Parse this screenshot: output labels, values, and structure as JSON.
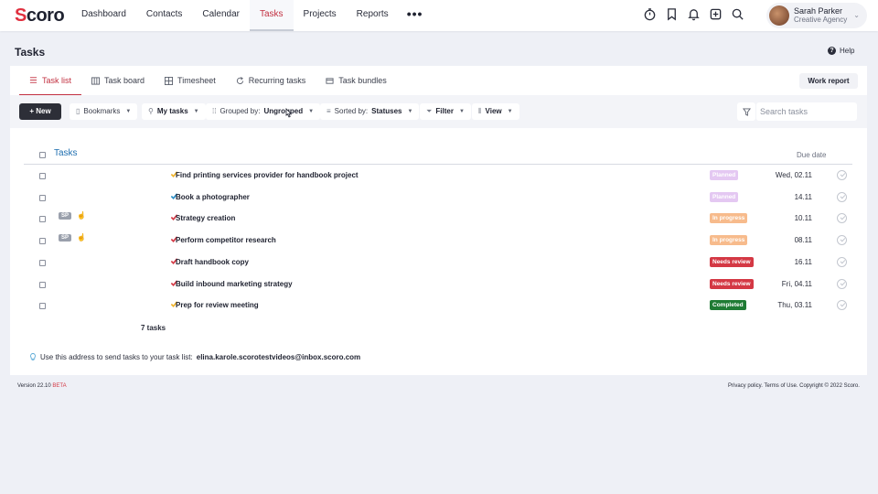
{
  "app": {
    "logo_text": "Scoro",
    "nav": [
      {
        "label": "Dashboard",
        "active": false
      },
      {
        "label": "Contacts",
        "active": false
      },
      {
        "label": "Calendar",
        "active": false
      },
      {
        "label": "Tasks",
        "active": true
      },
      {
        "label": "Projects",
        "active": false
      },
      {
        "label": "Reports",
        "active": false
      }
    ],
    "more_label": "•••",
    "icons": [
      "timer-icon",
      "bookmark-icon",
      "bell-icon",
      "add-icon",
      "search-icon"
    ],
    "user": {
      "name": "Sarah Parker",
      "org": "Creative Agency"
    }
  },
  "page": {
    "title": "Tasks",
    "help_label": "Help"
  },
  "tabs": [
    {
      "label": "Task list",
      "icon": "list-icon",
      "active": true
    },
    {
      "label": "Task board",
      "icon": "board-icon",
      "active": false
    },
    {
      "label": "Timesheet",
      "icon": "grid-icon",
      "active": false
    },
    {
      "label": "Recurring tasks",
      "icon": "recurring-icon",
      "active": false
    },
    {
      "label": "Task bundles",
      "icon": "bundle-icon",
      "active": false
    }
  ],
  "work_report_label": "Work report",
  "toolbar": {
    "new_label": "+ New",
    "bookmarks_label": "Bookmarks",
    "my_tasks_label": "My tasks",
    "grouped_prefix": "Grouped by:",
    "grouped_value": "Ungrouped",
    "sorted_prefix": "Sorted by:",
    "sorted_value": "Statuses",
    "filter_label": "Filter",
    "view_label": "View",
    "search_placeholder": "Search tasks"
  },
  "list": {
    "title": "Tasks",
    "due_header": "Due date",
    "count_label": "7 tasks",
    "tasks": [
      {
        "name": "Find printing services provider for handbook project",
        "tick_color": "#f0b429",
        "status": "Planned",
        "status_class": "st-planned",
        "due": "Wed, 02.11",
        "sp": false
      },
      {
        "name": "Book a photographer",
        "tick_color": "#2b8fc7",
        "status": "Planned",
        "status_class": "st-planned",
        "due": "14.11",
        "sp": false
      },
      {
        "name": "Strategy creation",
        "tick_color": "#d43844",
        "status": "In progress",
        "status_class": "st-progress",
        "due": "10.11",
        "sp": true
      },
      {
        "name": "Perform competitor research",
        "tick_color": "#d43844",
        "status": "In progress",
        "status_class": "st-progress",
        "due": "08.11",
        "sp": true
      },
      {
        "name": "Draft handbook copy",
        "tick_color": "#d43844",
        "status": "Needs review",
        "status_class": "st-review",
        "due": "16.11",
        "sp": false
      },
      {
        "name": "Build inbound marketing strategy",
        "tick_color": "#d43844",
        "status": "Needs review",
        "status_class": "st-review",
        "due": "Fri, 04.11",
        "sp": false
      },
      {
        "name": "Prep for review meeting",
        "tick_color": "#f0b429",
        "status": "Completed",
        "status_class": "st-complete",
        "due": "Thu, 03.11",
        "sp": false
      }
    ],
    "sp_label": "SP"
  },
  "email_note": {
    "text": "Use this address to send tasks to your task list:",
    "address": "elina.karole.scorotestvideos@inbox.scoro.com"
  },
  "footer": {
    "version": "Version 22.10",
    "beta": "BETA",
    "right": "Privacy policy. Terms of Use. Copyright © 2022 Scoro."
  }
}
